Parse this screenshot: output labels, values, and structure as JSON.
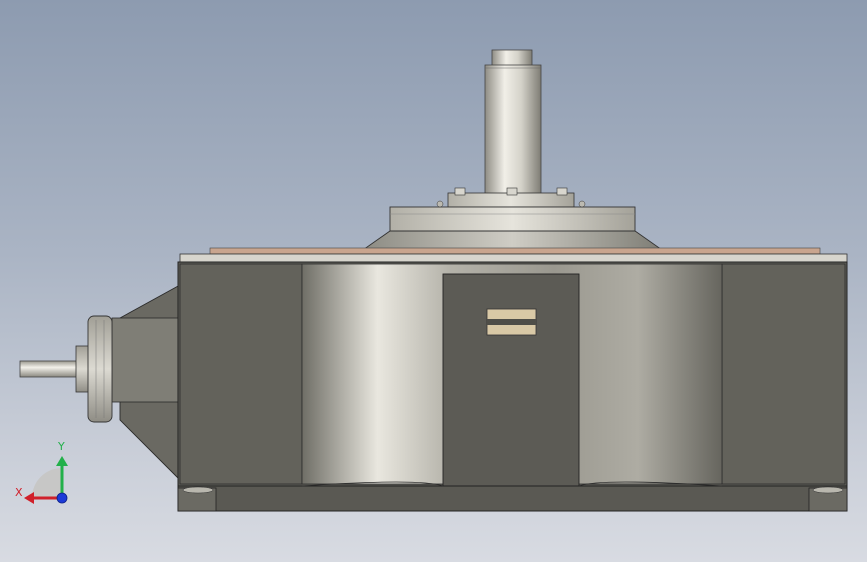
{
  "viewport": {
    "background_top": "#8d9bb0",
    "background_bottom": "#d8dbe2"
  },
  "model": {
    "subject": "gear-reducer",
    "body_color": "#5f5e58",
    "shaft_color": "#c8c6bc"
  },
  "triad": {
    "x_label": "X",
    "y_label": "Y",
    "x_color": "#d0202a",
    "y_color": "#22b04a",
    "z_color": "#1c3ad8"
  }
}
